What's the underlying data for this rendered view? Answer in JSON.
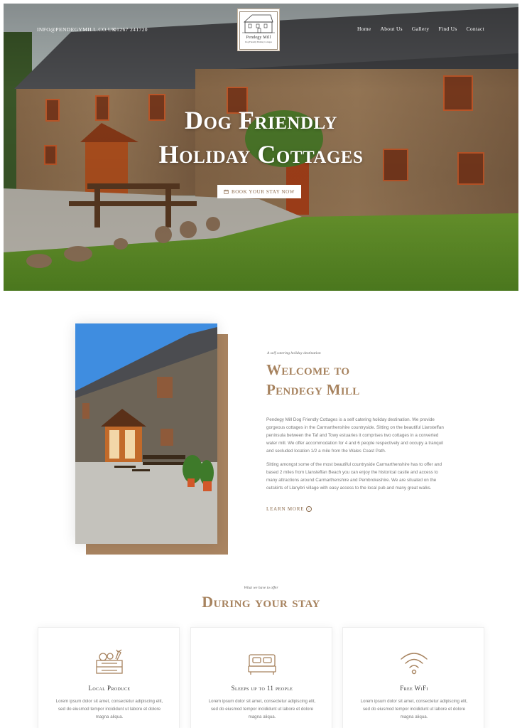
{
  "header": {
    "email": "INFO@PENDEGYMILL.CO.UK",
    "phone": "01267 241720",
    "logo": {
      "name": "Pendegy Mill",
      "tagline": "Dog Friendly Holiday Cottages"
    },
    "nav": [
      "Home",
      "About Us",
      "Gallery",
      "Find Us",
      "Contact"
    ]
  },
  "hero": {
    "title_line1": "Dog Friendly",
    "title_line2": "Holiday Cottages",
    "button_label": "BOOK YOUR STAY NOW"
  },
  "welcome": {
    "kicker": "A self catering holiday destination",
    "title_line1": "Welcome to",
    "title_line2": "Pendegy Mill",
    "paragraph1": "Pendegy Mill Dog Friendly Cottages is a self catering holiday destination.  We provide gorgeous cottages in the Carmarthenshire countryside.   Sitting on the beautiful Llansteffan peninsula between the Taf and Towy estuaries it comprises two cottages in a converted water mill. We offer accommodation for 4 and 6 people respectively and occupy a tranquil and secluded location 1/2 a mile from the Wales Coast Path.",
    "paragraph2": "Sitting amongst some of the most beautiful countryside Carmarthenshire has to offer and based 2 miles from Llansteffan Beach you can enjoy the  historical castle and access to many attractions around Carmarthenshire and Pembrokeshire. We are situated on the outskirts of Llanybri village with easy access to the local pub and many great walks.",
    "learn_more": "LEARN MORE"
  },
  "stay": {
    "kicker": "What we have to offer",
    "title": "During your stay",
    "cards": [
      {
        "icon": "produce-crate-icon",
        "title": "Local Produce",
        "text": "Lorem ipsum dolor sit amet, consectetur adipiscing elit, sed do eiusmod tempor incididunt ut labore et dolore magna aliqua."
      },
      {
        "icon": "bed-icon",
        "title": "Sleeps up to 11 people",
        "text": "Lorem ipsum dolor sit amet, consectetur adipiscing elit, sed do eiusmod tempor incididunt ut labore et dolore magna aliqua."
      },
      {
        "icon": "wifi-icon",
        "title": "Free WiFi",
        "text": "Lorem ipsum dolor sit amet, consectetur adipiscing elit, sed do eiusmod tempor incididunt ut labore et dolore magna aliqua."
      }
    ]
  },
  "colors": {
    "accent": "#a7835f",
    "accent_dark": "#8a6a4c",
    "photo_block": "#a98461"
  }
}
